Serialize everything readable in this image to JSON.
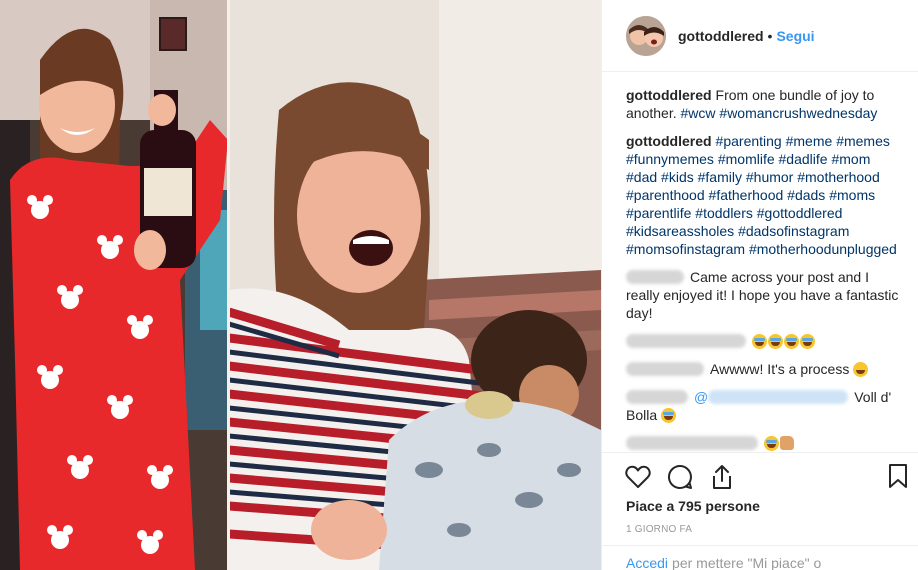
{
  "post": {
    "username": "gottoddlered",
    "follow_label": "Segui",
    "separator": "•"
  },
  "comments": [
    {
      "user": "gottoddlered",
      "text": "From one bundle of joy to another.",
      "tags": [
        "#wcw",
        "#womancrushwednesday"
      ]
    },
    {
      "user": "gottoddlered",
      "tags": [
        "#parenting",
        "#meme",
        "#memes",
        "#funnymemes",
        "#momlife",
        "#dadlife",
        "#mom",
        "#dad",
        "#kids",
        "#family",
        "#humor",
        "#motherhood",
        "#parenthood",
        "#fatherhood",
        "#dads",
        "#moms",
        "#parentlife",
        "#toddlers",
        "#gottoddlered",
        "#kidsareassholes",
        "#dadsofinstagram",
        "#momsofinstagram",
        "#motherhoodunplugged"
      ]
    },
    {
      "text": "Came across your post and I really enjoyed it! I hope you have a fantastic day!"
    },
    {
      "text": ""
    },
    {
      "text": "Awwww! It's a process"
    },
    {
      "text_before": "",
      "text_after": "Voll d' Bolla"
    },
    {
      "text": ""
    }
  ],
  "actions": {
    "likes_text": "Piace a 795 persone",
    "time_ago": "1 giorno fa",
    "login_link": "Accedi",
    "login_text": "per mettere \"Mi piace\" o"
  },
  "icons": {
    "like": "heart-icon",
    "comment": "comment-icon",
    "share": "share-icon",
    "save": "bookmark-icon"
  },
  "colors": {
    "link": "#3897f0",
    "hashtag": "#003569",
    "muted": "#999999"
  }
}
